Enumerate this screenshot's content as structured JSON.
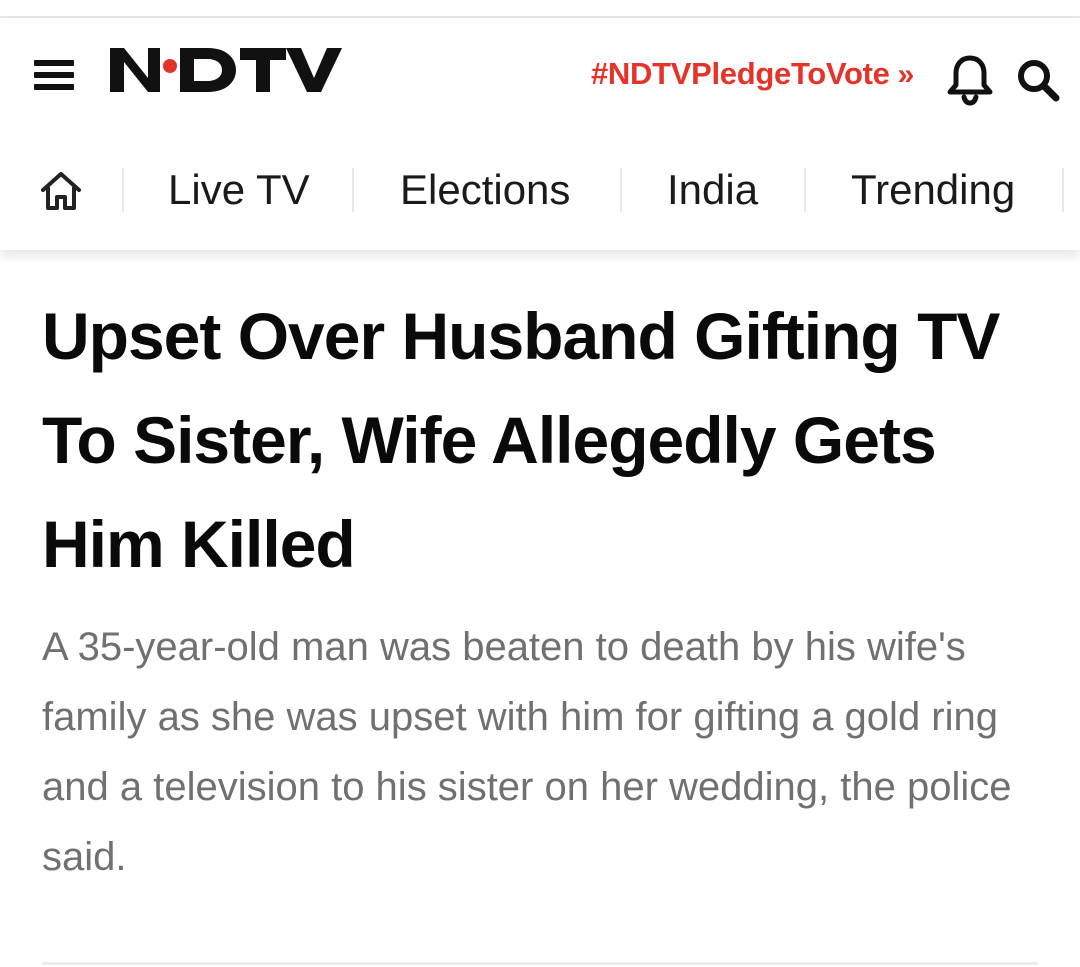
{
  "header": {
    "logo_text": "NDTV",
    "pledge_label": "#NDTVPledgeToVote",
    "pledge_chevron": "»",
    "icons": {
      "menu": "hamburger-menu-icon",
      "bell": "bell-icon",
      "search": "search-icon",
      "home": "home-icon"
    },
    "brand_red": "#e6332a"
  },
  "nav": {
    "items": [
      {
        "label": "Live TV"
      },
      {
        "label": "Elections"
      },
      {
        "label": "India"
      },
      {
        "label": "Trending"
      }
    ]
  },
  "article": {
    "headline": "Upset Over Husband Gifting TV To Sister, Wife Allegedly Gets Him Killed",
    "summary": "A 35-year-old man was beaten to death by his wife's family as she was upset with him for gifting a gold ring and a television to his sister on her wedding, the police said."
  }
}
